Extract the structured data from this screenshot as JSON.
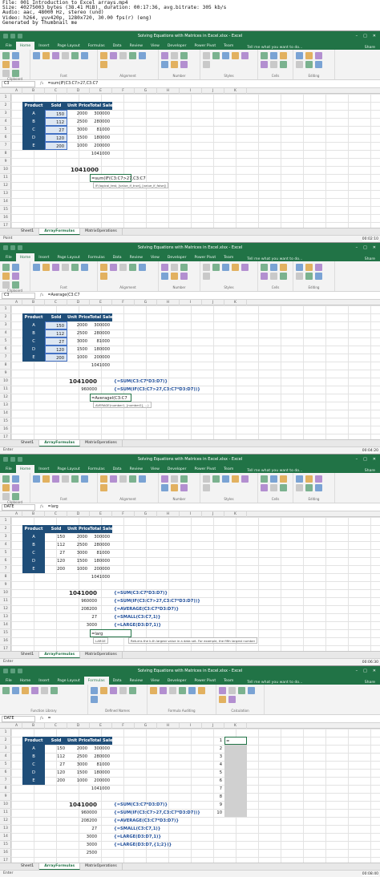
{
  "header": {
    "lines": [
      "File: 001 Introduction to Excel arrays.mp4",
      "Size: 40275003 bytes (38.41 MiB), duration: 00:17:36, avg.bitrate: 305 kb/s",
      "Audio: aac, 48000 Hz, stereo (und)",
      "Video: h264, yuv420p, 1280x720, 30.00 fps(r) (eng)",
      "Generated by Thumbnail me"
    ]
  },
  "app": {
    "title": "Solving Equations with Matrices in Excel.xlsx - Excel",
    "tell": "Tell me what you want to do...",
    "share": "Share",
    "win": [
      "–",
      "□",
      "✕"
    ]
  },
  "tabs": [
    "File",
    "Home",
    "Insert",
    "Page Layout",
    "Formulas",
    "Data",
    "Review",
    "View",
    "Developer",
    "Power Pivot",
    "Team"
  ],
  "sheets": [
    "Sheet1",
    "ArrayFormulas",
    "MatrixOperations"
  ],
  "cols": [
    "A",
    "B",
    "C",
    "D",
    "E",
    "F",
    "G",
    "H",
    "I",
    "J",
    "K"
  ],
  "table": {
    "headers": [
      "Product",
      "Sold",
      "Unit Price",
      "Total Sales"
    ],
    "rows": [
      [
        "A",
        "150",
        "2000",
        "300000"
      ],
      [
        "B",
        "112",
        "2500",
        "280000"
      ],
      [
        "C",
        "27",
        "3000",
        "81000"
      ],
      [
        "D",
        "120",
        "1500",
        "180000"
      ],
      [
        "E",
        "200",
        "1000",
        "200000"
      ]
    ],
    "total": "1041000"
  },
  "frames": [
    {
      "tab": "Home",
      "name": "C3",
      "formula": "=sum(IF(C3:C7>27,C3:C7",
      "status": "Point",
      "ts": "00:02:10",
      "groups": [
        "Clipboard",
        "Font",
        "Alignment",
        "Number",
        "Styles",
        "Cells",
        "Editing"
      ],
      "big": "1041000",
      "edit": "=sum(IF(C3:C7>27,C3:C7",
      "tip": "IF(logical_test, [value_if_true], [value_if_false])"
    },
    {
      "tab": "Home",
      "name": "C3",
      "formula": "=Average(C3:C7",
      "status": "Enter",
      "ts": "00:04:20",
      "groups": [
        "Clipboard",
        "Font",
        "Alignment",
        "Number",
        "Styles",
        "Cells",
        "Editing"
      ],
      "lines": [
        [
          "1041000",
          "{=SUM(C3:C7*D3:D7)}"
        ],
        [
          "960000",
          "{=SUM(IF(C3:C7>27,C3:C7*D3:D7))}"
        ]
      ],
      "edit": "=Averagel(C3:C7",
      "tip": "AVERAGE(number1, [number2], ...)"
    },
    {
      "tab": "Home",
      "name": "DATE",
      "formula": "=larg",
      "status": "Enter",
      "ts": "00:06:30",
      "groups": [
        "Clipboard",
        "Font",
        "Alignment",
        "Number",
        "Styles",
        "Cells",
        "Editing"
      ],
      "lines": [
        [
          "1041000",
          "{=SUM(C3:C7*D3:D7)}"
        ],
        [
          "960000",
          "{=SUM(IF(C3:C7>27,C3:C7*D3:D7))}"
        ],
        [
          "208200",
          "{=AVERAGE(C3:C7*D3:D7)}"
        ],
        [
          "27",
          "{=SMALL(C3:C7,1)}"
        ],
        [
          "3000",
          "{=LARGE(D3:D7,1)}"
        ]
      ],
      "edit": "=larg",
      "tip": "LARGE",
      "tip2": "Returns the k-th largest value in a data set. For example, the fifth largest number"
    },
    {
      "tab": "Formulas",
      "name": "DATE",
      "formula": "=",
      "status": "Enter",
      "ts": "00:08:40",
      "groups": [
        "Function Library",
        "Defined Names",
        "Formula Auditing",
        "Calculation"
      ],
      "lines": [
        [
          "1041000",
          "{=SUM(C3:C7*D3:D7)}"
        ],
        [
          "960000",
          "{=SUM(IF(C3:C7>27,C3:C7*D3:D7))}"
        ],
        [
          "208200",
          "{=AVERAGE(C3:C7*D3:D7)}"
        ],
        [
          "27",
          "{=SMALL(C3:C7,1)}"
        ],
        [
          "3000",
          "{=LARGE(D3:D7,1)}"
        ],
        [
          "3000",
          "{=LARGE(D3:D7,{1;2})}"
        ],
        [
          "2500",
          ""
        ]
      ],
      "kvals": [
        "1",
        "2",
        "3",
        "4",
        "5",
        "6",
        "7",
        "8",
        "9",
        "10"
      ],
      "kedit": "="
    }
  ]
}
